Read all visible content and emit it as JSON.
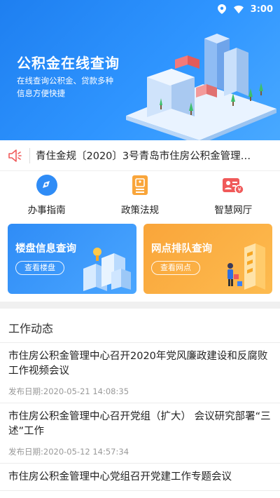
{
  "statusbar": {
    "time": "3:00",
    "icons": [
      "location-icon",
      "wifi-icon"
    ]
  },
  "hero": {
    "title": "公积金在线查询",
    "subtitle_line1": "在线查询公积金、贷款多种",
    "subtitle_line2": "信息方便快捷"
  },
  "notice": {
    "icon": "speaker-icon",
    "text": "青住金规〔2020〕3号青岛市住房公积金管理…"
  },
  "menu": {
    "items": [
      {
        "label": "办事指南",
        "icon": "compass-icon"
      },
      {
        "label": "政策法规",
        "icon": "document-icon"
      },
      {
        "label": "智慧网厅",
        "icon": "id-card-icon"
      }
    ]
  },
  "cards": {
    "property": {
      "title": "楼盘信息查询",
      "button": "查看楼盘"
    },
    "outlet": {
      "title": "网点排队查询",
      "button": "查看网点"
    }
  },
  "news": {
    "header": "工作动态",
    "date_prefix": "发布日期:",
    "items": [
      {
        "title": "市住房公积金管理中心召开2020年党风廉政建设和反腐败工作视频会议",
        "date": "发布日期:2020-05-21 14:08:35"
      },
      {
        "title": "市住房公积金管理中心召开党组（扩大） 会议研究部署“三述”工作",
        "date": "发布日期:2020-05-12 14:57:34"
      },
      {
        "title": "市住房公积金管理中心党组召开党建工作专题会议",
        "date": ""
      }
    ]
  },
  "colors": {
    "primary": "#2f8cf6",
    "accent_orange": "#fdb44a",
    "icon_red": "#f05a5a"
  }
}
